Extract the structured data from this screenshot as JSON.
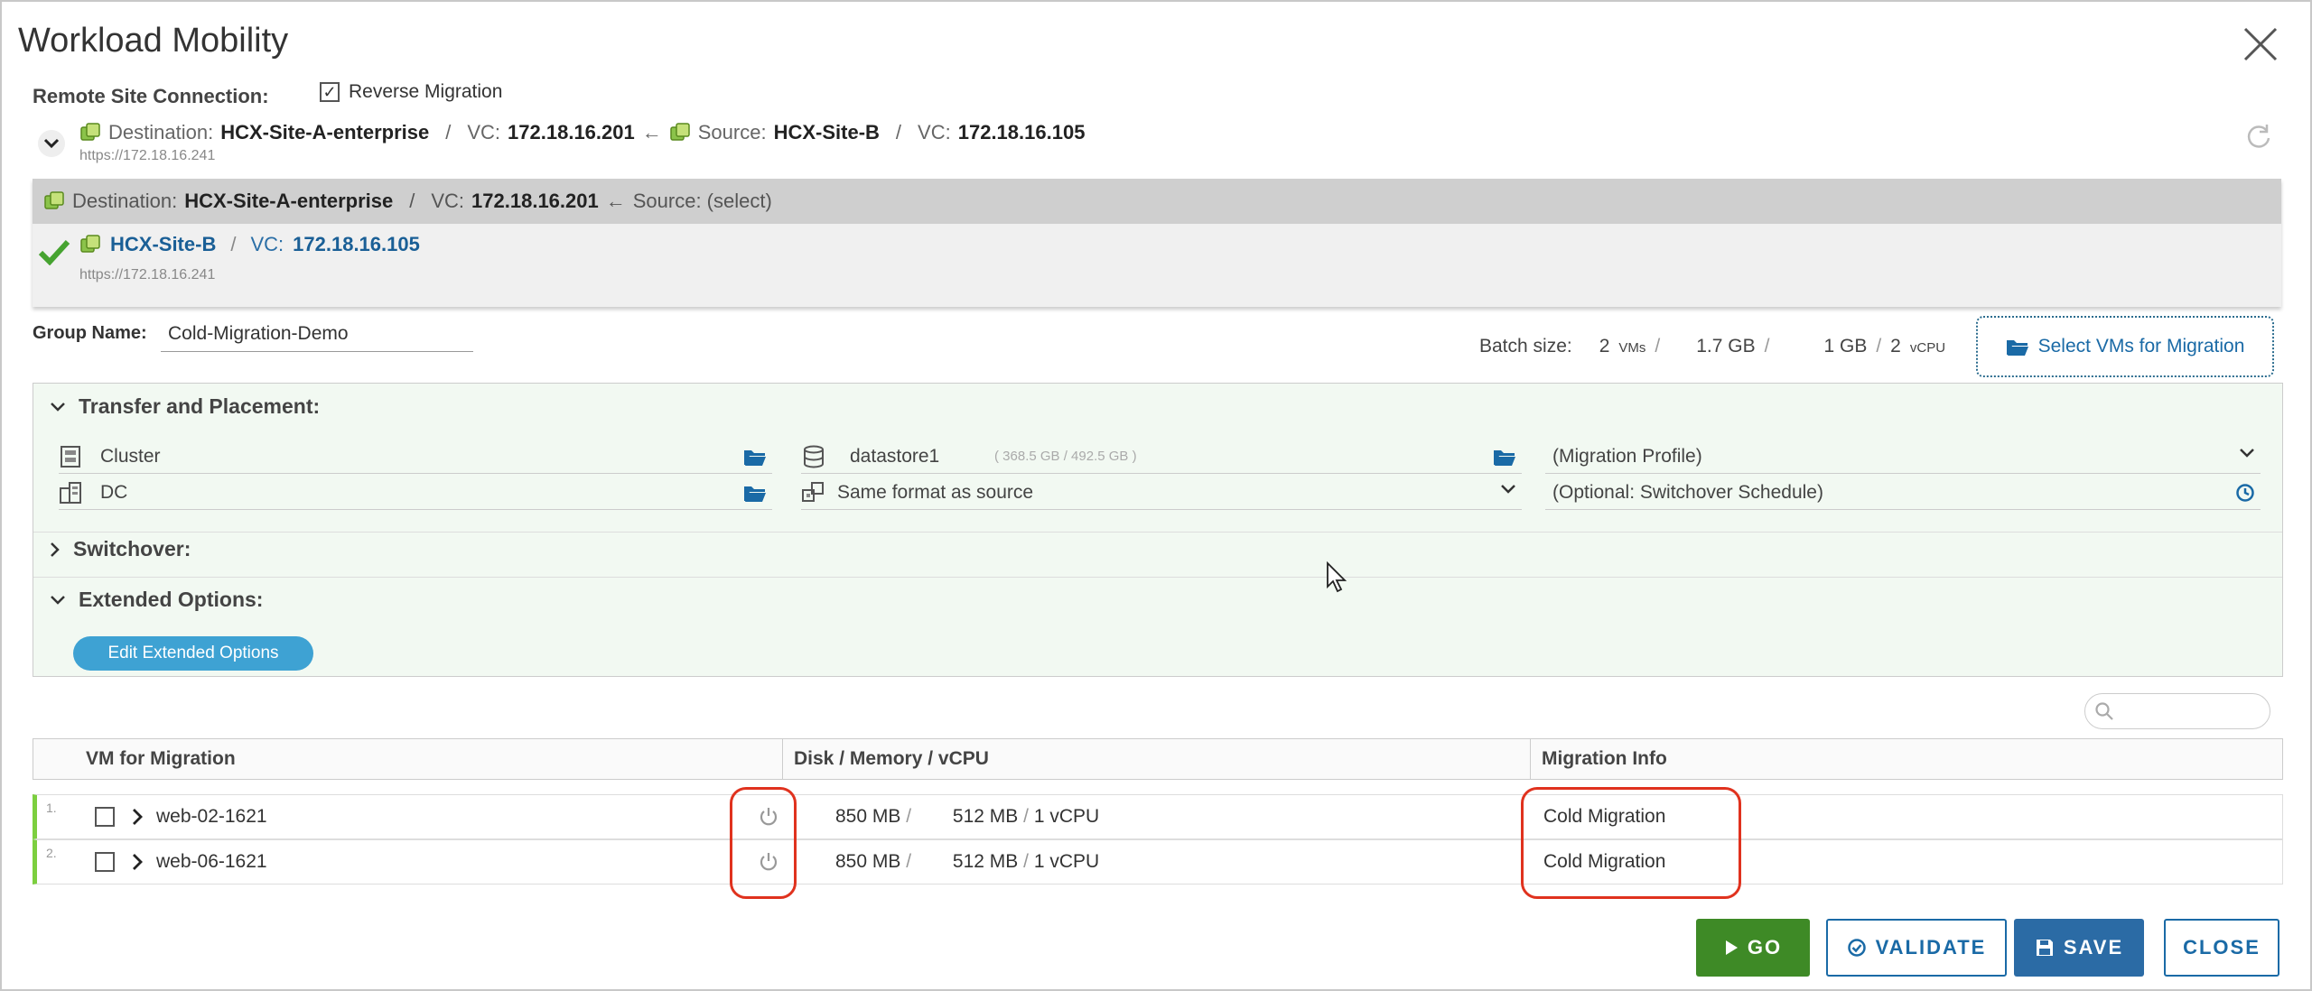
{
  "window": {
    "title": "Workload Mobility"
  },
  "remote": {
    "label": "Remote Site Connection:",
    "reverse_label": "Reverse Migration",
    "reverse_checked_glyph": "✓",
    "dest_label": "Destination:",
    "dest_site": "HCX-Site-A-enterprise",
    "sep": "/",
    "vc_label": "VC:",
    "dest_vc": "172.18.16.201",
    "arrow": "←",
    "source_label": "Source:",
    "source_site": "HCX-Site-B",
    "source_vc": "172.18.16.105",
    "url": "https://172.18.16.241"
  },
  "dropdown": {
    "head_dest_label": "Destination:",
    "head_dest_site": "HCX-Site-A-enterprise",
    "head_vc_label": "VC:",
    "head_vc": "172.18.16.201",
    "head_source": "Source: (select)",
    "item_site": "HCX-Site-B",
    "item_vc_label": "VC:",
    "item_vc": "172.18.16.105",
    "item_url": "https://172.18.16.241"
  },
  "group": {
    "label": "Group Name:",
    "value": "Cold-Migration-Demo"
  },
  "batch": {
    "label": "Batch size:",
    "vms_count": "2",
    "vms_unit": "VMs",
    "disk": "1.7 GB",
    "memory": "1 GB",
    "vcpu_count": "2",
    "vcpu_unit": "vCPU",
    "slash": "/"
  },
  "select_vms_label": "Select VMs for Migration",
  "transfer": {
    "title": "Transfer and Placement:",
    "cluster": "Cluster",
    "dc": "DC",
    "datastore": "datastore1",
    "datastore_size": "( 368.5 GB / 492.5 GB )",
    "format": "Same format as source",
    "profile": "(Migration Profile)",
    "schedule": "(Optional: Switchover Schedule)"
  },
  "switchover": {
    "title": "Switchover:"
  },
  "extended": {
    "title": "Extended Options:",
    "edit_label": "Edit Extended Options"
  },
  "grid": {
    "columns": [
      "VM for Migration",
      "Disk / Memory / vCPU",
      "Migration Info"
    ],
    "rows": [
      {
        "num": "1.",
        "name": "web-02-1621",
        "disk": "850 MB",
        "memory": "512 MB",
        "vcpu": "1 vCPU",
        "info": "Cold Migration"
      },
      {
        "num": "2.",
        "name": "web-06-1621",
        "disk": "850 MB",
        "memory": "512 MB",
        "vcpu": "1 vCPU",
        "info": "Cold Migration"
      }
    ]
  },
  "buttons": {
    "go": "GO",
    "validate": "VALIDATE",
    "save": "SAVE",
    "close": "CLOSE"
  },
  "colors": {
    "accent": "#1a6aa6",
    "go": "#3e8a26",
    "save": "#2b6ba5",
    "highlight": "#e0321e",
    "panel": "#f2f9f2"
  }
}
